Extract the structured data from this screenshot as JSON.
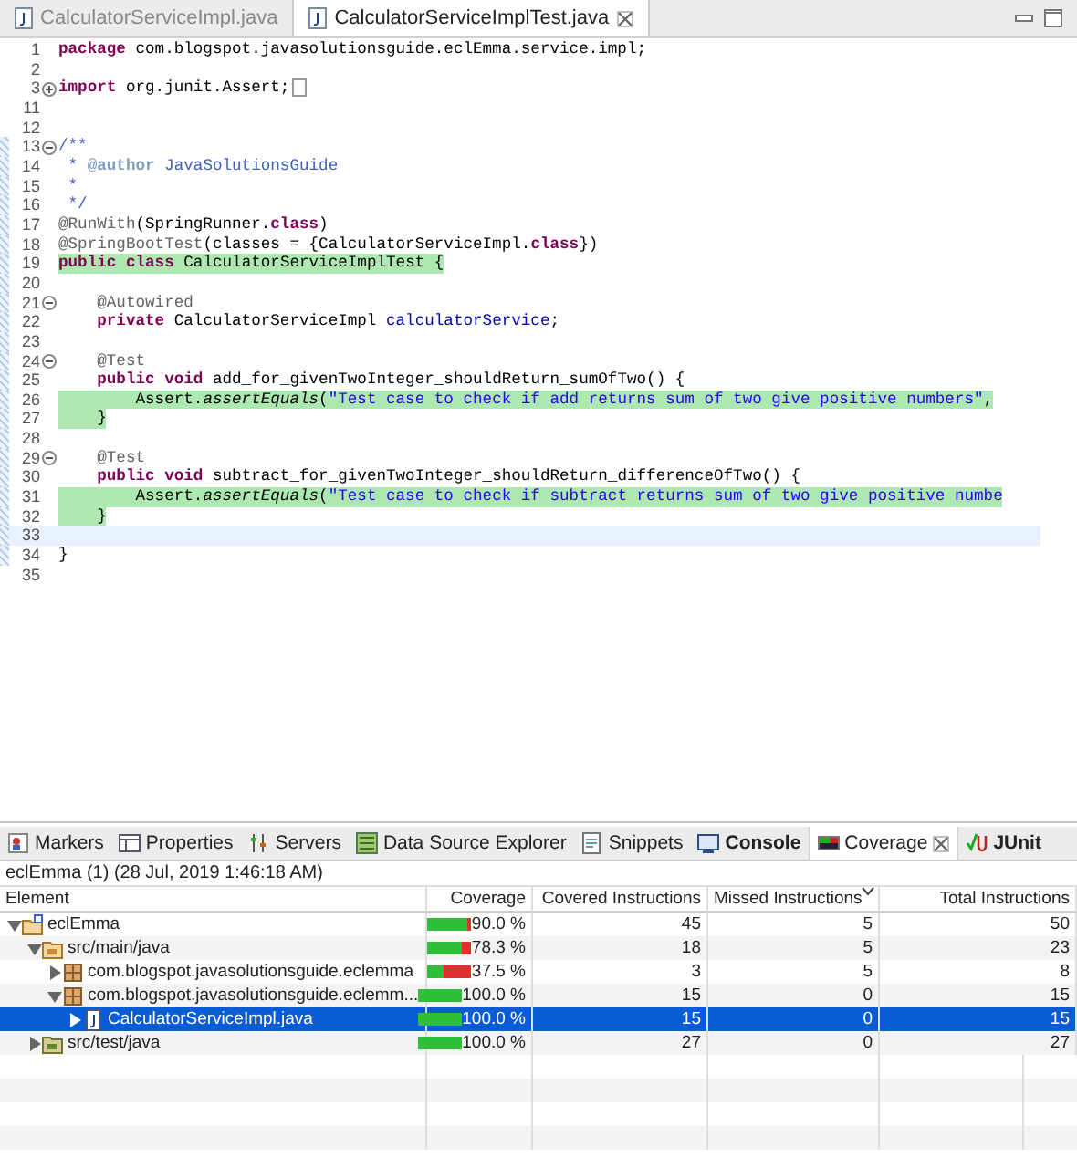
{
  "editor_tabs": [
    {
      "label": "CalculatorServiceImpl.java",
      "selected": false
    },
    {
      "label": "CalculatorServiceImplTest.java",
      "selected": true,
      "closable": true
    }
  ],
  "code_lines": [
    {
      "number": "1",
      "tokens": [
        {
          "kind": "keyword",
          "text": "package"
        },
        {
          "kind": "plain",
          "text": " com.blogspot.javasolutionsguide.eclEmma.service.impl;"
        }
      ]
    },
    {
      "number": "2"
    },
    {
      "number": "3",
      "foldable": true,
      "folded": true,
      "tokens": [
        {
          "kind": "keyword",
          "text": "import"
        },
        {
          "kind": "plain",
          "text": " org.junit.Assert;"
        }
      ]
    },
    {
      "number": "11"
    },
    {
      "number": "12"
    },
    {
      "number": "13",
      "foldable": true,
      "folded": false,
      "changed": true,
      "tokens": [
        {
          "kind": "javadoc",
          "text": "/**"
        }
      ]
    },
    {
      "number": "14",
      "changed": true,
      "tokens": [
        {
          "kind": "javadoc",
          "text": " * "
        },
        {
          "kind": "javadoc-tag",
          "text": "@author"
        },
        {
          "kind": "javadoc",
          "text": " JavaSolutionsGuide"
        }
      ]
    },
    {
      "number": "15",
      "changed": true,
      "tokens": [
        {
          "kind": "javadoc",
          "text": " *"
        }
      ]
    },
    {
      "number": "16",
      "changed": true,
      "tokens": [
        {
          "kind": "javadoc",
          "text": " */"
        }
      ]
    },
    {
      "number": "17",
      "changed": true,
      "tokens": [
        {
          "kind": "annotation",
          "text": "@RunWith"
        },
        {
          "kind": "plain",
          "text": "(SpringRunner."
        },
        {
          "kind": "keyword",
          "text": "class"
        },
        {
          "kind": "plain",
          "text": ")"
        }
      ]
    },
    {
      "number": "18",
      "changed": true,
      "tokens": [
        {
          "kind": "annotation",
          "text": "@SpringBootTest"
        },
        {
          "kind": "plain",
          "text": "(classes = {CalculatorServiceImpl."
        },
        {
          "kind": "keyword",
          "text": "class"
        },
        {
          "kind": "plain",
          "text": "})"
        }
      ]
    },
    {
      "number": "19",
      "changed": true,
      "covered": true,
      "tokens": [
        {
          "kind": "keyword",
          "text": "public"
        },
        {
          "kind": "keyword",
          "text": " class"
        },
        {
          "kind": "plain",
          "text": " CalculatorServiceImplTest {"
        }
      ]
    },
    {
      "number": "20",
      "changed": true
    },
    {
      "number": "21",
      "foldable": true,
      "folded": false,
      "changed": true,
      "tokens": [
        {
          "kind": "annotation",
          "text": "    @Autowired"
        }
      ]
    },
    {
      "number": "22",
      "changed": true,
      "tokens": [
        {
          "kind": "keyword",
          "text": "    private"
        },
        {
          "kind": "plain",
          "text": " CalculatorServiceImpl "
        },
        {
          "kind": "field",
          "text": "calculatorService"
        },
        {
          "kind": "plain",
          "text": ";"
        }
      ]
    },
    {
      "number": "23",
      "changed": true
    },
    {
      "number": "24",
      "foldable": true,
      "folded": false,
      "changed": true,
      "tokens": [
        {
          "kind": "annotation",
          "text": "    @Test"
        }
      ]
    },
    {
      "number": "25",
      "changed": true,
      "tokens": [
        {
          "kind": "keyword",
          "text": "    public"
        },
        {
          "kind": "keyword",
          "text": " void"
        },
        {
          "kind": "plain",
          "text": " add_for_givenTwoInteger_shouldReturn_sumOfTwo() {"
        }
      ]
    },
    {
      "number": "26",
      "changed": true,
      "covered": true,
      "tokens": [
        {
          "kind": "plain",
          "text": "        Assert."
        },
        {
          "kind": "static",
          "text": "assertEquals"
        },
        {
          "kind": "plain",
          "text": "("
        },
        {
          "kind": "string",
          "text": "\"Test case to check if add returns sum of two give positive numbers\""
        },
        {
          "kind": "plain",
          "text": ","
        }
      ]
    },
    {
      "number": "27",
      "changed": true,
      "covered": true,
      "tokens": [
        {
          "kind": "plain",
          "text": "    }"
        }
      ]
    },
    {
      "number": "28",
      "changed": true
    },
    {
      "number": "29",
      "foldable": true,
      "folded": false,
      "changed": true,
      "tokens": [
        {
          "kind": "annotation",
          "text": "    @Test"
        }
      ]
    },
    {
      "number": "30",
      "changed": true,
      "tokens": [
        {
          "kind": "keyword",
          "text": "    public"
        },
        {
          "kind": "keyword",
          "text": " void"
        },
        {
          "kind": "plain",
          "text": " subtract_for_givenTwoInteger_shouldReturn_differenceOfTwo() {"
        }
      ]
    },
    {
      "number": "31",
      "changed": true,
      "covered": true,
      "tokens": [
        {
          "kind": "plain",
          "text": "        Assert."
        },
        {
          "kind": "static",
          "text": "assertEquals"
        },
        {
          "kind": "plain",
          "text": "("
        },
        {
          "kind": "string",
          "text": "\"Test case to check if subtract returns sum of two give positive numbe"
        }
      ]
    },
    {
      "number": "32",
      "changed": true,
      "covered": true,
      "tokens": [
        {
          "kind": "plain",
          "text": "    }"
        }
      ]
    },
    {
      "number": "33",
      "changed": true,
      "current": true
    },
    {
      "number": "34",
      "changed": true,
      "tokens": [
        {
          "kind": "plain",
          "text": "}"
        }
      ]
    },
    {
      "number": "35"
    }
  ],
  "view_tabs": [
    {
      "kind": "markers",
      "label": "Markers",
      "selected": false,
      "attention": false
    },
    {
      "kind": "properties",
      "label": "Properties",
      "selected": false,
      "attention": false
    },
    {
      "kind": "servers",
      "label": "Servers",
      "selected": false,
      "attention": false
    },
    {
      "kind": "data-source",
      "label": "Data Source Explorer",
      "selected": false,
      "attention": false
    },
    {
      "kind": "snippets",
      "label": "Snippets",
      "selected": false,
      "attention": false
    },
    {
      "kind": "console",
      "label": "Console",
      "selected": false,
      "attention": true
    },
    {
      "kind": "coverage",
      "label": "Coverage",
      "selected": true,
      "attention": false,
      "closable": true
    },
    {
      "kind": "junit",
      "label": "JUnit",
      "selected": false,
      "attention": true
    }
  ],
  "coverage": {
    "session": "eclEmma (1) (28 Jul, 2019 1:46:18 AM)",
    "columns": [
      {
        "label": "Element"
      },
      {
        "label": "Coverage"
      },
      {
        "label": "Covered Instructions"
      },
      {
        "label": "Missed Instructions",
        "sorted": true
      },
      {
        "label": "Total Instructions"
      }
    ],
    "rows": [
      {
        "kind": "project",
        "name": "eclEmma",
        "expanded": true,
        "selected": false,
        "level": 0.9,
        "coverage": "90.0 %",
        "covered": "45",
        "missed": "5",
        "total": "50",
        "children": [
          {
            "kind": "source-folder",
            "name": "src/main/java",
            "expanded": true,
            "selected": false,
            "level": 0.783,
            "coverage": "78.3 %",
            "covered": "18",
            "missed": "5",
            "total": "23",
            "children": [
              {
                "kind": "package",
                "name": "com.blogspot.javasolutionsguide.eclemma",
                "expanded": false,
                "selected": false,
                "level": 0.375,
                "coverage": "37.5 %",
                "covered": "3",
                "missed": "5",
                "total": "8"
              },
              {
                "kind": "package",
                "name": "com.blogspot.javasolutionsguide.eclemm...",
                "expanded": true,
                "selected": false,
                "level": 1,
                "coverage": "100.0 %",
                "covered": "15",
                "missed": "0",
                "total": "15",
                "children": [
                  {
                    "kind": "java-file",
                    "name": "CalculatorServiceImpl.java",
                    "expanded": false,
                    "selected": true,
                    "level": 1,
                    "coverage": "100.0 %",
                    "covered": "15",
                    "missed": "0",
                    "total": "15"
                  }
                ]
              }
            ]
          },
          {
            "kind": "test-folder",
            "name": "src/test/java",
            "expanded": false,
            "selected": false,
            "level": 1,
            "coverage": "100.0 %",
            "covered": "27",
            "missed": "0",
            "total": "27"
          }
        ]
      }
    ]
  }
}
